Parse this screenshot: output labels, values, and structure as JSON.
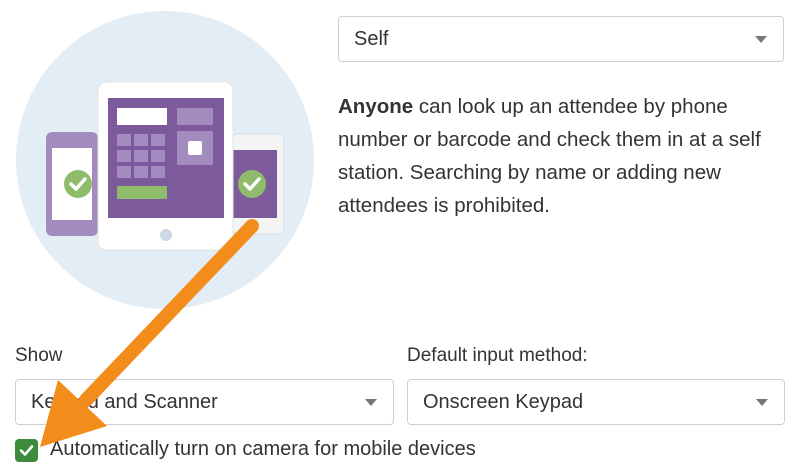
{
  "mode_select": {
    "value": "Self"
  },
  "description": {
    "bold": "Anyone",
    "rest": " can look up an attendee by phone number or barcode and check them in at a self station. Searching by name or adding new attendees is prohibited."
  },
  "show": {
    "label": "Show",
    "value": "Keypad and Scanner"
  },
  "input_method": {
    "label": "Default input method:",
    "value": "Onscreen Keypad"
  },
  "camera_option": {
    "checked": true,
    "label": "Automatically turn on camera for mobile devices"
  },
  "colors": {
    "purple": "#7d5a9b",
    "light_purple": "#a38bbf",
    "circle_bg": "#e2edf5",
    "check_green": "#3c8a3c",
    "arrow_orange": "#f28c1b"
  }
}
